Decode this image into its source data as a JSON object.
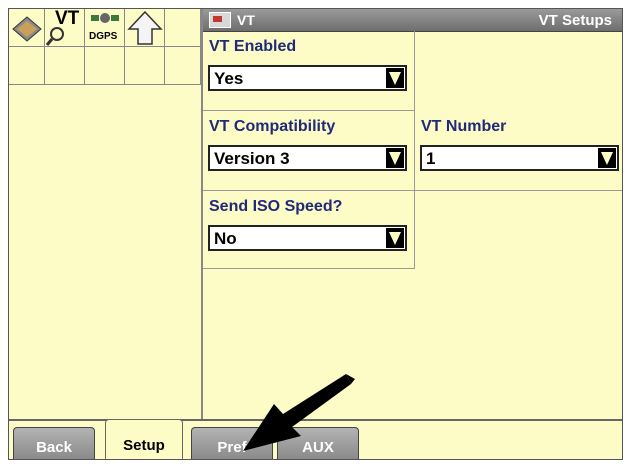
{
  "titlebar": {
    "app_label": "VT",
    "screen_title": "VT Setups"
  },
  "icons": {
    "vt_label": "VT",
    "dgps_label": "DGPS"
  },
  "fields": {
    "vt_enabled": {
      "label": "VT Enabled",
      "value": "Yes"
    },
    "vt_compatibility": {
      "label": "VT Compatibility",
      "value": "Version 3"
    },
    "vt_number": {
      "label": "VT Number",
      "value": "1"
    },
    "send_iso_speed": {
      "label": "Send ISO Speed?",
      "value": "No"
    }
  },
  "tabs": {
    "back": "Back",
    "setup": "Setup",
    "pref": "Pref",
    "aux": "AUX"
  },
  "colors": {
    "screen_bg": "#fdfbc6",
    "label_blue": "#1f2a7a",
    "titlebar": "#7d7d7d"
  }
}
